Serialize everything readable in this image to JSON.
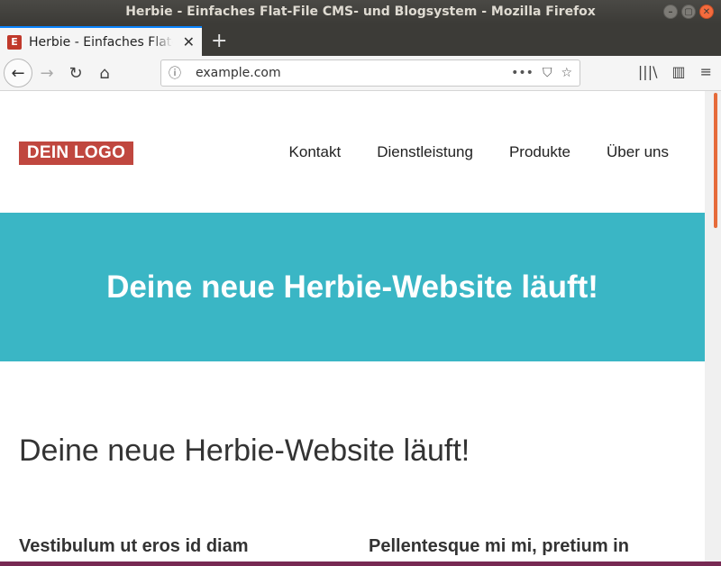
{
  "window": {
    "title": "Herbie - Einfaches Flat-File CMS- und Blogsystem - Mozilla Firefox",
    "controls": [
      "–",
      "▢",
      "✕"
    ]
  },
  "tab": {
    "favicon": "E",
    "title": "Herbie - Einfaches Flat-File CMS- und Blogsystem",
    "close": "✕",
    "new_tab": "+"
  },
  "navbar": {
    "back": "←",
    "forward": "→",
    "reload": "↻",
    "home": "⌂",
    "url": "example.com",
    "info_icon": "ⓘ",
    "more": "•••",
    "pocket": "⛉",
    "bookmark": "☆",
    "library": "|||\\",
    "sidebar": "▥",
    "menu": "≡"
  },
  "site": {
    "logo": "DEIN LOGO",
    "menu": [
      "Kontakt",
      "Dienstleistung",
      "Produkte",
      "Über uns"
    ],
    "hero_title": "Deine neue Herbie-Website läuft!",
    "content_title": "Deine neue Herbie-Website läuft!",
    "columns": [
      "Vestibulum ut eros id diam",
      "Pellentesque mi mi, pretium in"
    ]
  },
  "colors": {
    "logo_bg": "#c0473f",
    "hero_bg": "#3ab6c5",
    "tab_accent": "#0a84ff"
  }
}
